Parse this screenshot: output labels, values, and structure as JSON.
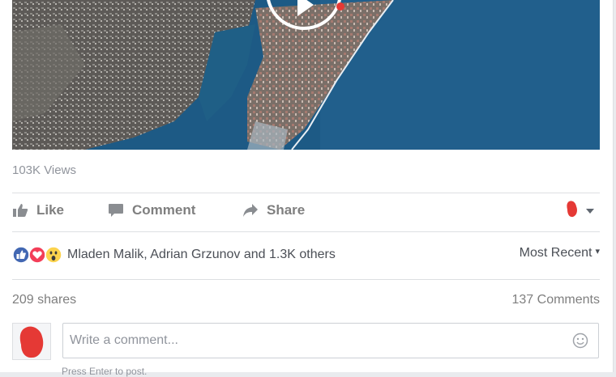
{
  "video": {
    "stats": {
      "views_label": "103K Views"
    }
  },
  "actions": {
    "like_label": "Like",
    "comment_label": "Comment",
    "share_label": "Share"
  },
  "reactions": {
    "icons": [
      "like-icon",
      "love-icon",
      "wow-icon"
    ],
    "summary_text": "Mladen Malik, Adrian Grzunov and 1.3K others",
    "sort_label": "Most Recent",
    "sort_caret": "▾"
  },
  "counts": {
    "shares_label": "209 shares",
    "comments_label": "137 Comments"
  },
  "composer": {
    "placeholder": "Write a comment...",
    "hint": "Press Enter to post."
  },
  "colors": {
    "like_blue": "#4267b2",
    "love_red": "#f33e58",
    "wow_yellow": "#fcd34d",
    "redacted_red": "#e53935"
  }
}
